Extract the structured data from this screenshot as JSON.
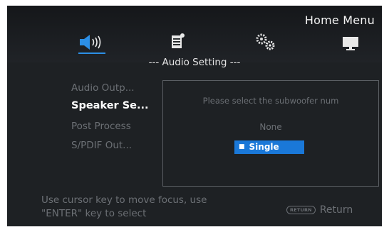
{
  "header": {
    "title": "Home Menu"
  },
  "tabs": [
    {
      "name": "audio",
      "icon": "speaker-icon",
      "selected": true
    },
    {
      "name": "document",
      "icon": "document-icon",
      "selected": false
    },
    {
      "name": "settings",
      "icon": "gears-icon",
      "selected": false
    },
    {
      "name": "display",
      "icon": "monitor-icon",
      "selected": false
    }
  ],
  "section": {
    "title": "--- Audio Setting ---"
  },
  "menu": {
    "items": [
      {
        "label": "Audio Outp...",
        "active": false
      },
      {
        "label": "Speaker Se...",
        "active": true
      },
      {
        "label": "Post Process",
        "active": false
      },
      {
        "label": "S/PDIF Out...",
        "active": false
      }
    ]
  },
  "dialog": {
    "prompt": "Please select the subwoofer num",
    "options": [
      {
        "label": "None",
        "selected": false
      },
      {
        "label": "Single",
        "selected": true
      }
    ]
  },
  "footer": {
    "hint_line1": "Use cursor key to move focus, use",
    "hint_line2": "\"ENTER\" key to select",
    "return_badge": "RETURN",
    "return_label": "Return"
  },
  "colors": {
    "background": "#1e2124",
    "accent": "#1a78d8",
    "text_active": "#ffffff",
    "text_dim": "#6c7075"
  }
}
